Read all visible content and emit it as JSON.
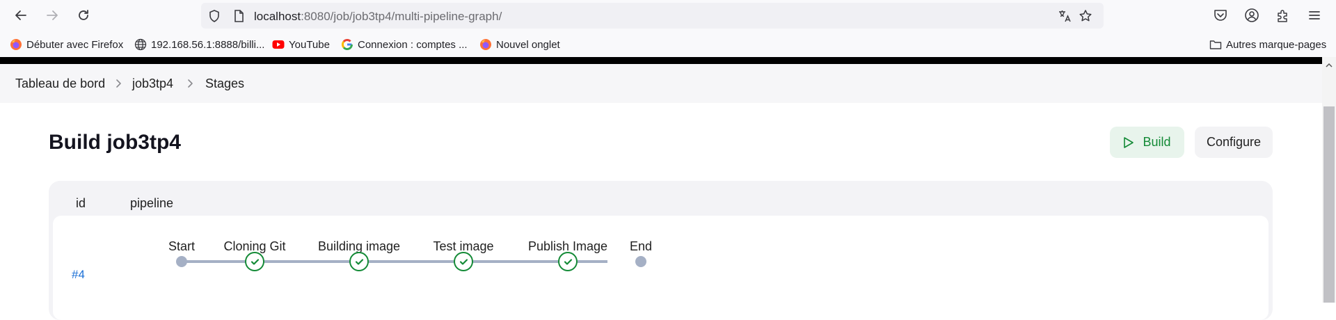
{
  "browser": {
    "url_host": "localhost",
    "url_path": ":8080/job/job3tp4/multi-pipeline-graph/",
    "bookmarks": [
      {
        "label": "Débuter avec Firefox",
        "icon": "firefox-icon"
      },
      {
        "label": "192.168.56.1:8888/billi...",
        "icon": "globe-icon"
      },
      {
        "label": "YouTube",
        "icon": "youtube-icon"
      },
      {
        "label": "Connexion : comptes ...",
        "icon": "google-icon"
      },
      {
        "label": "Nouvel onglet",
        "icon": "firefox-icon"
      }
    ],
    "other_bookmarks": "Autres marque-pages"
  },
  "breadcrumb": [
    "Tableau de bord",
    "job3tp4",
    "Stages"
  ],
  "page": {
    "title": "Build job3tp4",
    "build_button": "Build",
    "configure_button": "Configure"
  },
  "table": {
    "headers": [
      "id",
      "pipeline"
    ],
    "rows": [
      {
        "id": "#4",
        "stages": [
          {
            "label": "Start",
            "status": "start"
          },
          {
            "label": "Cloning Git",
            "status": "success"
          },
          {
            "label": "Building image",
            "status": "success"
          },
          {
            "label": "Test image",
            "status": "success"
          },
          {
            "label": "Publish Image",
            "status": "success"
          },
          {
            "label": "End",
            "status": "end"
          }
        ]
      }
    ]
  },
  "colors": {
    "success": "#138a36",
    "link": "#1a6fd6",
    "pipeline_line": "#a5b0c5"
  }
}
